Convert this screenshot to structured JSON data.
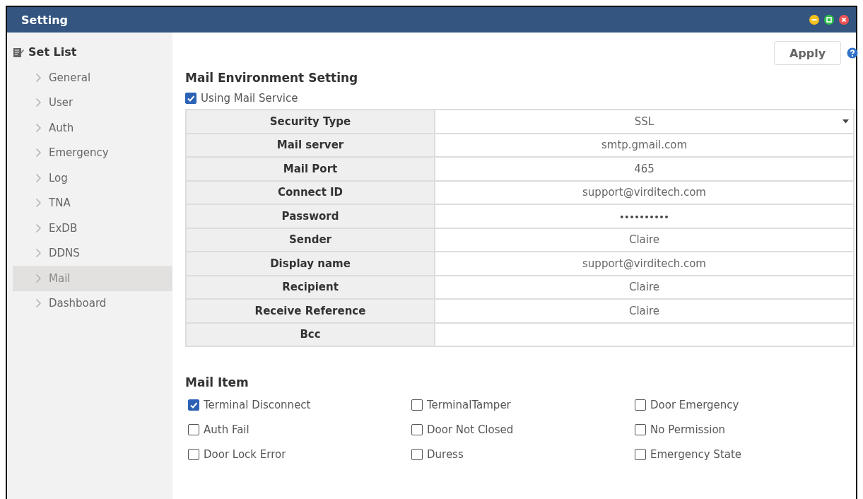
{
  "window": {
    "title": "Setting"
  },
  "sidebar": {
    "title": "Set List",
    "items": [
      {
        "label": "General",
        "selected": false
      },
      {
        "label": "User",
        "selected": false
      },
      {
        "label": "Auth",
        "selected": false
      },
      {
        "label": "Emergency",
        "selected": false
      },
      {
        "label": "Log",
        "selected": false
      },
      {
        "label": "TNA",
        "selected": false
      },
      {
        "label": "ExDB",
        "selected": false
      },
      {
        "label": "DDNS",
        "selected": false
      },
      {
        "label": "Mail",
        "selected": true
      },
      {
        "label": "Dashboard",
        "selected": false
      }
    ]
  },
  "toolbar": {
    "apply": "Apply"
  },
  "mail_environment": {
    "title": "Mail Environment Setting",
    "using_mail_service": {
      "label": "Using Mail Service",
      "checked": true
    },
    "rows": [
      {
        "label": "Security Type",
        "value": "SSL",
        "kind": "select"
      },
      {
        "label": "Mail server",
        "value": "smtp.gmail.com",
        "kind": "text"
      },
      {
        "label": "Mail Port",
        "value": "465",
        "kind": "text"
      },
      {
        "label": "Connect ID",
        "value": "support@virditech.com",
        "kind": "text"
      },
      {
        "label": "Password",
        "value": "••••••••••",
        "kind": "password"
      },
      {
        "label": "Sender",
        "value": "Claire",
        "kind": "text"
      },
      {
        "label": "Display name",
        "value": "support@virditech.com",
        "kind": "text"
      },
      {
        "label": "Recipient",
        "value": "Claire",
        "kind": "text"
      },
      {
        "label": "Receive Reference",
        "value": "Claire",
        "kind": "text"
      },
      {
        "label": "Bcc",
        "kind": "text"
      }
    ]
  },
  "mail_item": {
    "title": "Mail Item",
    "items": [
      {
        "label": "Terminal Disconnect",
        "checked": true
      },
      {
        "label": "TerminalTamper",
        "checked": false
      },
      {
        "label": "Door Emergency",
        "checked": false
      },
      {
        "label": "Auth Fail",
        "checked": false
      },
      {
        "label": "Door Not Closed",
        "checked": false
      },
      {
        "label": "No Permission",
        "checked": false
      },
      {
        "label": "Door Lock Error",
        "checked": false
      },
      {
        "label": "Duress",
        "checked": false
      },
      {
        "label": "Emergency State",
        "checked": false
      }
    ]
  }
}
